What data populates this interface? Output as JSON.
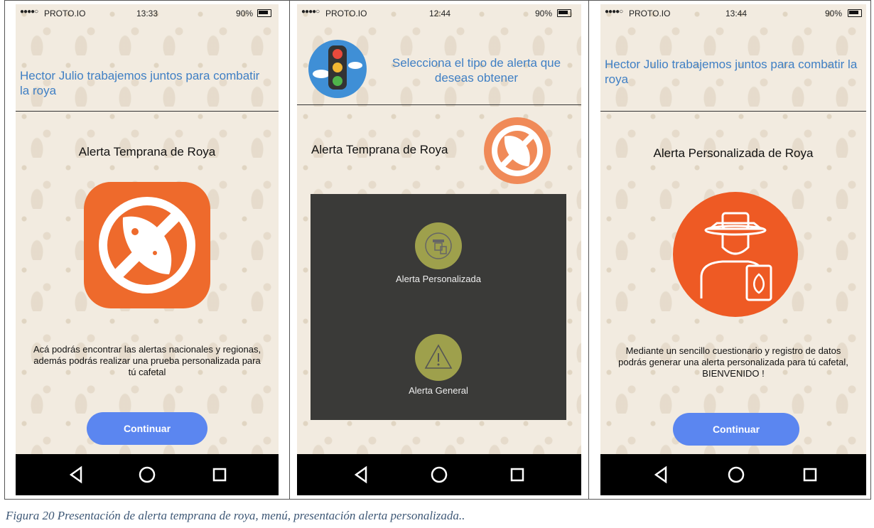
{
  "colors": {
    "accent_orange": "#ee6a2c",
    "button_blue": "#5b86f0",
    "header_blue": "#3f7fc4",
    "menu_olive": "#9ea04c",
    "overlay_dark": "#3a3a38"
  },
  "screens": [
    {
      "status": {
        "dots": "●●●●○",
        "carrier": "PROTO.IO",
        "time": "13:33",
        "battery": "90%"
      },
      "header": "Hector Julio trabajemos juntos para combatir la roya",
      "section_title": "Alerta Temprana de Roya",
      "icon": "rust-prohibited-leaf-icon",
      "description": "Acá podrás encontrar las alertas nacionales y regionas, además podrás realizar una prueba personalizada para tú cafetal",
      "button": "Continuar"
    },
    {
      "status": {
        "dots": "●●●●○",
        "carrier": "PROTO.IO",
        "time": "12:44",
        "battery": "90%"
      },
      "header": "Selecciona el tipo de alerta que deseas obtener",
      "header_icon": "traffic-light-icon",
      "section_title": "Alerta Temprana de Roya",
      "menu": [
        {
          "label": "Alerta Personalizada",
          "icon": "farmer-tablet-icon"
        },
        {
          "label": "Alerta General",
          "icon": "warning-triangle-icon"
        }
      ]
    },
    {
      "status": {
        "dots": "●●●●○",
        "carrier": "PROTO.IO",
        "time": "13:44",
        "battery": "90%"
      },
      "header": "Hector Julio trabajemos juntos para combatir la roya",
      "section_title": "Alerta Personalizada de Roya",
      "icon": "farmer-tablet-icon",
      "description": "Mediante un sencillo cuestionario y registro de datos podrás generar una alerta personalizada para tú cafetal, BIENVENIDO !",
      "button": "Continuar"
    }
  ],
  "navbar": {
    "back": "back-triangle-icon",
    "home": "home-circle-icon",
    "recents": "recents-square-icon"
  },
  "caption": "Figura 20 Presentación de alerta temprana de roya, menú, presentación alerta personalizada.."
}
